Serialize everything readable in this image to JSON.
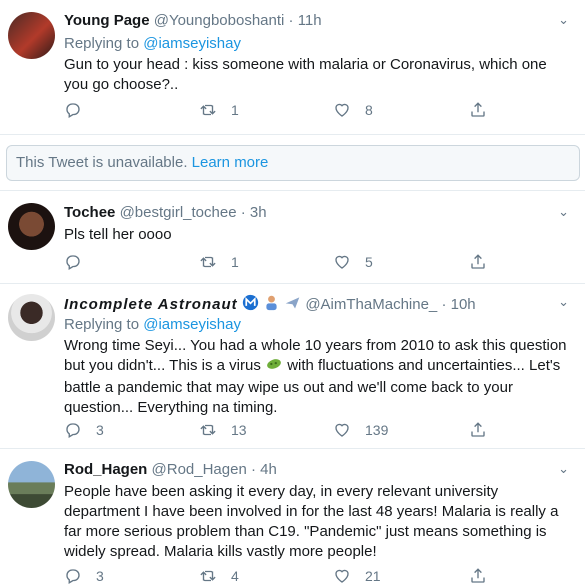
{
  "tweets": [
    {
      "name": "Young Page",
      "handle": "@Youngboboshanti",
      "dot": "·",
      "time": "11h",
      "replying_prefix": "Replying to",
      "replying_to": "@iamseyishay",
      "text": "Gun to your head : kiss someone with malaria or Coronavirus, which one you go choose?..",
      "replies": "",
      "retweets": "1",
      "likes": "8"
    },
    {
      "name": "Tochee",
      "handle": "@bestgirl_tochee",
      "dot": "·",
      "time": "3h",
      "text": "Pls tell her oooo",
      "replies": "",
      "retweets": "1",
      "likes": "5"
    },
    {
      "name": "Incomplete Astronaut",
      "handle": "@AimThaMachine_",
      "dot": "·",
      "time": "10h",
      "replying_prefix": "Replying to",
      "replying_to": "@iamseyishay",
      "text_part1": "Wrong time Seyi... You had a whole 10 years from 2010 to ask this question but you didn't... This is a virus",
      "text_part2": "with fluctuations and uncertainties... Let's battle a pandemic that may wipe us out and we'll come back to your question... Everything na timing.",
      "replies": "3",
      "retweets": "13",
      "likes": "139"
    },
    {
      "name": "Rod_Hagen",
      "handle": "@Rod_Hagen",
      "dot": "·",
      "time": "4h",
      "text": "People have been asking it every day, in every  relevant university department I have been involved in for the last 48 years! Malaria is really a far more serious problem than C19. \"Pandemic\" just means something is widely spread. Malaria kills vastly more people!",
      "replies": "3",
      "retweets": "4",
      "likes": "21"
    }
  ],
  "unavailable": {
    "text": "This Tweet is unavailable.",
    "link": "Learn more"
  },
  "colors": {
    "accent": "#1b95e0",
    "muted": "#657786",
    "border": "#e6ecf0"
  },
  "icons": [
    "reply-icon",
    "retweet-icon",
    "like-icon",
    "share-icon",
    "chevron-down-icon"
  ]
}
